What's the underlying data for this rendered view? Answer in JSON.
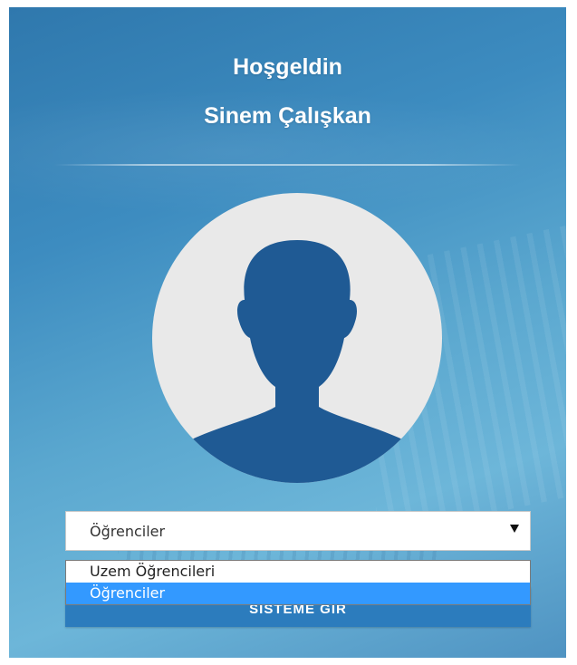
{
  "header": {
    "welcome": "Hoşgeldin",
    "user_name": "Sinem Çalışkan"
  },
  "avatar": {
    "icon": "user-silhouette-icon",
    "circle_color": "#e9e9e9",
    "silhouette_color": "#1f5a94"
  },
  "role_select": {
    "value": "Öğrenciler",
    "arrow_icon": "triangle-down-icon",
    "options": [
      {
        "label": "Uzem Öğrencileri",
        "selected": false
      },
      {
        "label": "Öğrenciler",
        "selected": true
      }
    ]
  },
  "login_button": {
    "label": "SİSTEME GİR"
  },
  "colors": {
    "accent": "#3399ff",
    "button": "#2c7cbd"
  }
}
